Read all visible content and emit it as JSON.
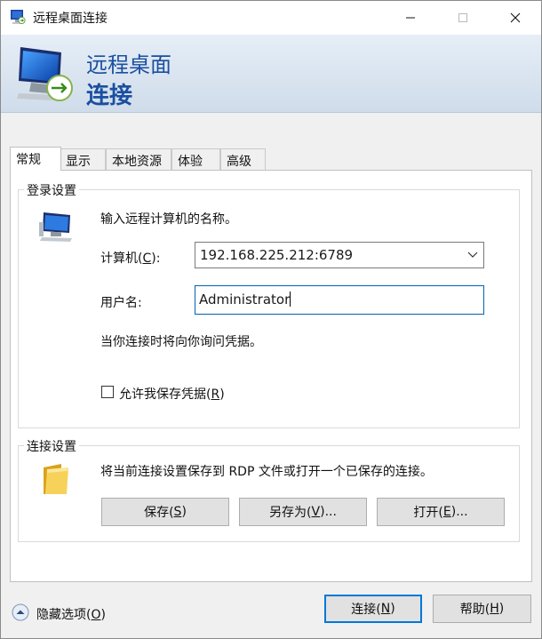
{
  "window": {
    "title": "远程桌面连接",
    "icon": "remote-desktop-icon"
  },
  "banner": {
    "line1": "远程桌面",
    "line2": "连接"
  },
  "tabs": [
    {
      "label": "常规",
      "active": true
    },
    {
      "label": "显示",
      "active": false
    },
    {
      "label": "本地资源",
      "active": false
    },
    {
      "label": "体验",
      "active": false
    },
    {
      "label": "高级",
      "active": false
    }
  ],
  "login": {
    "group_label": "登录设置",
    "instruction": "输入远程计算机的名称。",
    "computer_label_pre": "计算机(",
    "computer_label_key": "C",
    "computer_label_post": "):",
    "computer_value": "192.168.225.212:6789",
    "user_label": "用户名:",
    "user_value": "Administrator",
    "notice": "当你连接时将向你询问凭据。",
    "save_cred_pre": "允许我保存凭据(",
    "save_cred_key": "R",
    "save_cred_post": ")",
    "save_cred_checked": false
  },
  "connection": {
    "group_label": "连接设置",
    "description": "将当前连接设置保存到 RDP 文件或打开一个已保存的连接。",
    "save": {
      "pre": "保存(",
      "key": "S",
      "post": ")"
    },
    "save_as": {
      "pre": "另存为(",
      "key": "V",
      "post": ")..."
    },
    "open": {
      "pre": "打开(",
      "key": "E",
      "post": ")..."
    }
  },
  "footer": {
    "hide_options": {
      "pre": "隐藏选项(",
      "key": "O",
      "post": ")"
    },
    "connect": {
      "pre": "连接(",
      "key": "N",
      "post": ")"
    },
    "help": {
      "pre": "帮助(",
      "key": "H",
      "post": ")"
    }
  },
  "colors": {
    "accent": "#0078d7",
    "banner_text": "#1a4fa0"
  }
}
